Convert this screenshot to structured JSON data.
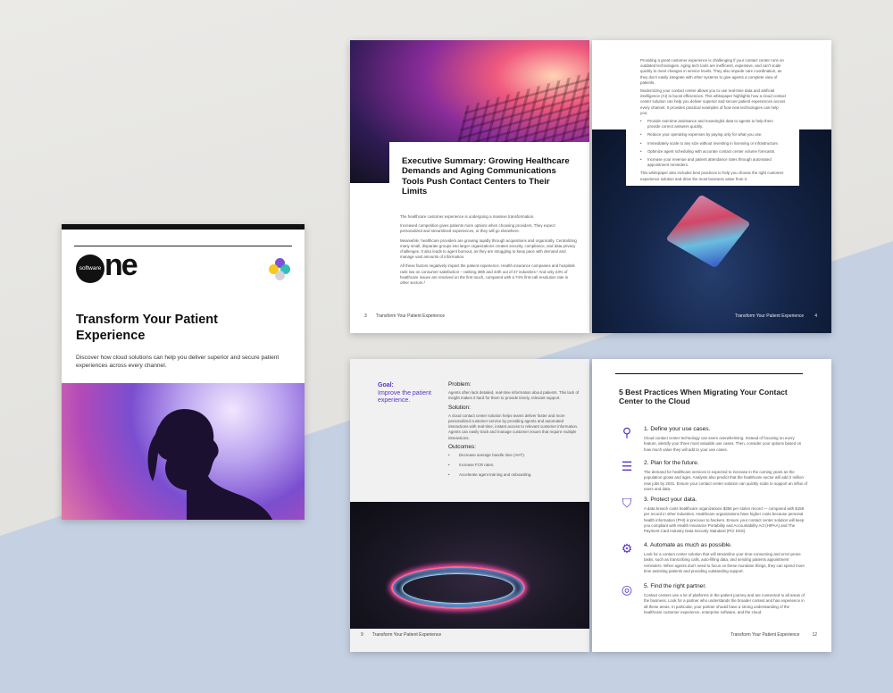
{
  "cover": {
    "logo_small": "software",
    "logo_big": "ne",
    "title": "Transform Your Patient Experience",
    "subtitle": "Discover how cloud solutions can help you deliver superior and secure patient experiences across every channel.",
    "mark_colors": [
      "#f5c400",
      "#1bb7b0",
      "#6b3fd1",
      "#cfcfcf"
    ]
  },
  "page3": {
    "title": "Executive Summary: Growing Healthcare Demands and Aging Communications Tools Push Contact Centers to Their Limits",
    "paragraphs": [
      "The healthcare customer experience is undergoing a massive transformation.",
      "Increased competition gives patients more options when choosing providers. They expect personalized and streamlined experiences, or they will go elsewhere.",
      "Meanwhile, healthcare providers are growing rapidly through acquisitions and organically. Centralizing many small, disparate groups into larger organizations creates security, compliance, and data privacy challenges. It also leads to agent burnout, as they are struggling to keep pace with demand and manage vast amounts of information.",
      "All these factors negatively impact the patient experience. Health insurance companies and hospitals rank low on consumer satisfaction – ranking 38th and 44th out of 47 industries.¹ And only 23% of healthcare issues are resolved on the first touch, compared with a 74% first-call-resolution rate in other sectors.²"
    ],
    "page_num": "3",
    "footer": "Transform Your Patient Experience"
  },
  "page4": {
    "paragraphs": [
      "Providing a great customer experience is challenging if your contact center runs on outdated technologies. Aging tech tools are inefficient, expensive, and can't scale quickly to meet changes in service levels. They also impede care coordination, as they don't easily integrate with other systems to give agents a complete view of patients.",
      "Modernizing your contact center allows you to use real-time data and artificial intelligence (AI) to boost efficiencies. This whitepaper highlights how a cloud contact center solution can help you deliver superior and secure patient experiences across every channel. It provides practical examples of how new technologies can help you:"
    ],
    "bullets": [
      "Provide real-time assistance and meaningful data to agents to help them provide correct answers quickly.",
      "Reduce your operating expenses by paying only for what you use.",
      "Immediately scale to any size without investing in licensing or infrastructure.",
      "Optimize agent scheduling with accurate contact center volume forecasts.",
      "Increase your revenue and patient attendance rates through automated appointment reminders."
    ],
    "closing": "This whitepaper also includes best practices to help you choose the right customer experience solution and drive the most business value from it.",
    "page_num": "4",
    "footer": "Transform Your Patient Experience"
  },
  "page9": {
    "goal_label": "Goal:",
    "goal_text": "Improve the patient experience.",
    "problem_heading": "Problem:",
    "problem_text": "Agents often lack detailed, real-time information about patients. This lack of insight makes it hard for them to provide timely, relevant support.",
    "solution_heading": "Solution:",
    "solution_text": "A cloud contact center solution helps teams deliver faster and more personalized customer service by providing agents and automated interactions with real-time, instant access to relevant customer information. Agents can easily track and manage customer issues that require multiple interactions.",
    "outcomes_heading": "Outcomes:",
    "outcomes": [
      "Decrease average handle time (AHT).",
      "Increase FCR rates.",
      "Accelerate agent training and onboarding."
    ],
    "page_num": "9",
    "footer": "Transform Your Patient Experience"
  },
  "page12": {
    "title": "5 Best Practices When Migrating Your Contact Center to the Cloud",
    "practices": [
      {
        "icon": "magnifier-icon",
        "glyph": "⚲",
        "heading": "1. Define your use cases.",
        "text": "Cloud contact center technology can seem overwhelming. Instead of focusing on every feature, identify your three most valuable use cases. Then, consider your options based on how much value they will add to your use cases."
      },
      {
        "icon": "checklist-icon",
        "glyph": "☰",
        "heading": "2. Plan for the future.",
        "text": "The demand for healthcare services is expected to increase in the coming years as the population grows and ages. Analysts also predict that the healthcare sector will add 2 million new jobs by 2031. Ensure your contact center solution can quickly scale to support an influx of users and data."
      },
      {
        "icon": "shield-icon",
        "glyph": "⛉",
        "heading": "3. Protect your data.",
        "text": "A data breach costs healthcare organizations $355 per stolen record — compared with $158 per record in other industries. Healthcare organizations have higher costs because personal health information (PHI) is precious to hackers. Ensure your contact center solution will keep you compliant with Health Insurance Portability and Accountability Act (HIPAA) and The Payment Card Industry Data Security Standard (PCI DSS)."
      },
      {
        "icon": "gear-icon",
        "glyph": "⚙",
        "heading": "4. Automate as much as possible.",
        "text": "Look for a contact center solution that will streamline your time-consuming and error-prone tasks, such as transcribing calls, auto-filling data, and sending patients appointment reminders. When agents don't need to focus on these mundane things, they can spend more time assisting patients and providing outstanding support."
      },
      {
        "icon": "target-icon",
        "glyph": "◎",
        "heading": "5. Find the right partner.",
        "text": "Contact centers use a lot of platforms in the patient journey and are connected to all areas of the business. Look for a partner who understands the broader context and has experience in all these areas. In particular, your partner should have a strong understanding of the healthcare customer experience, enterprise software, and the cloud."
      }
    ],
    "page_num": "12",
    "footer": "Transform Your Patient Experience"
  }
}
